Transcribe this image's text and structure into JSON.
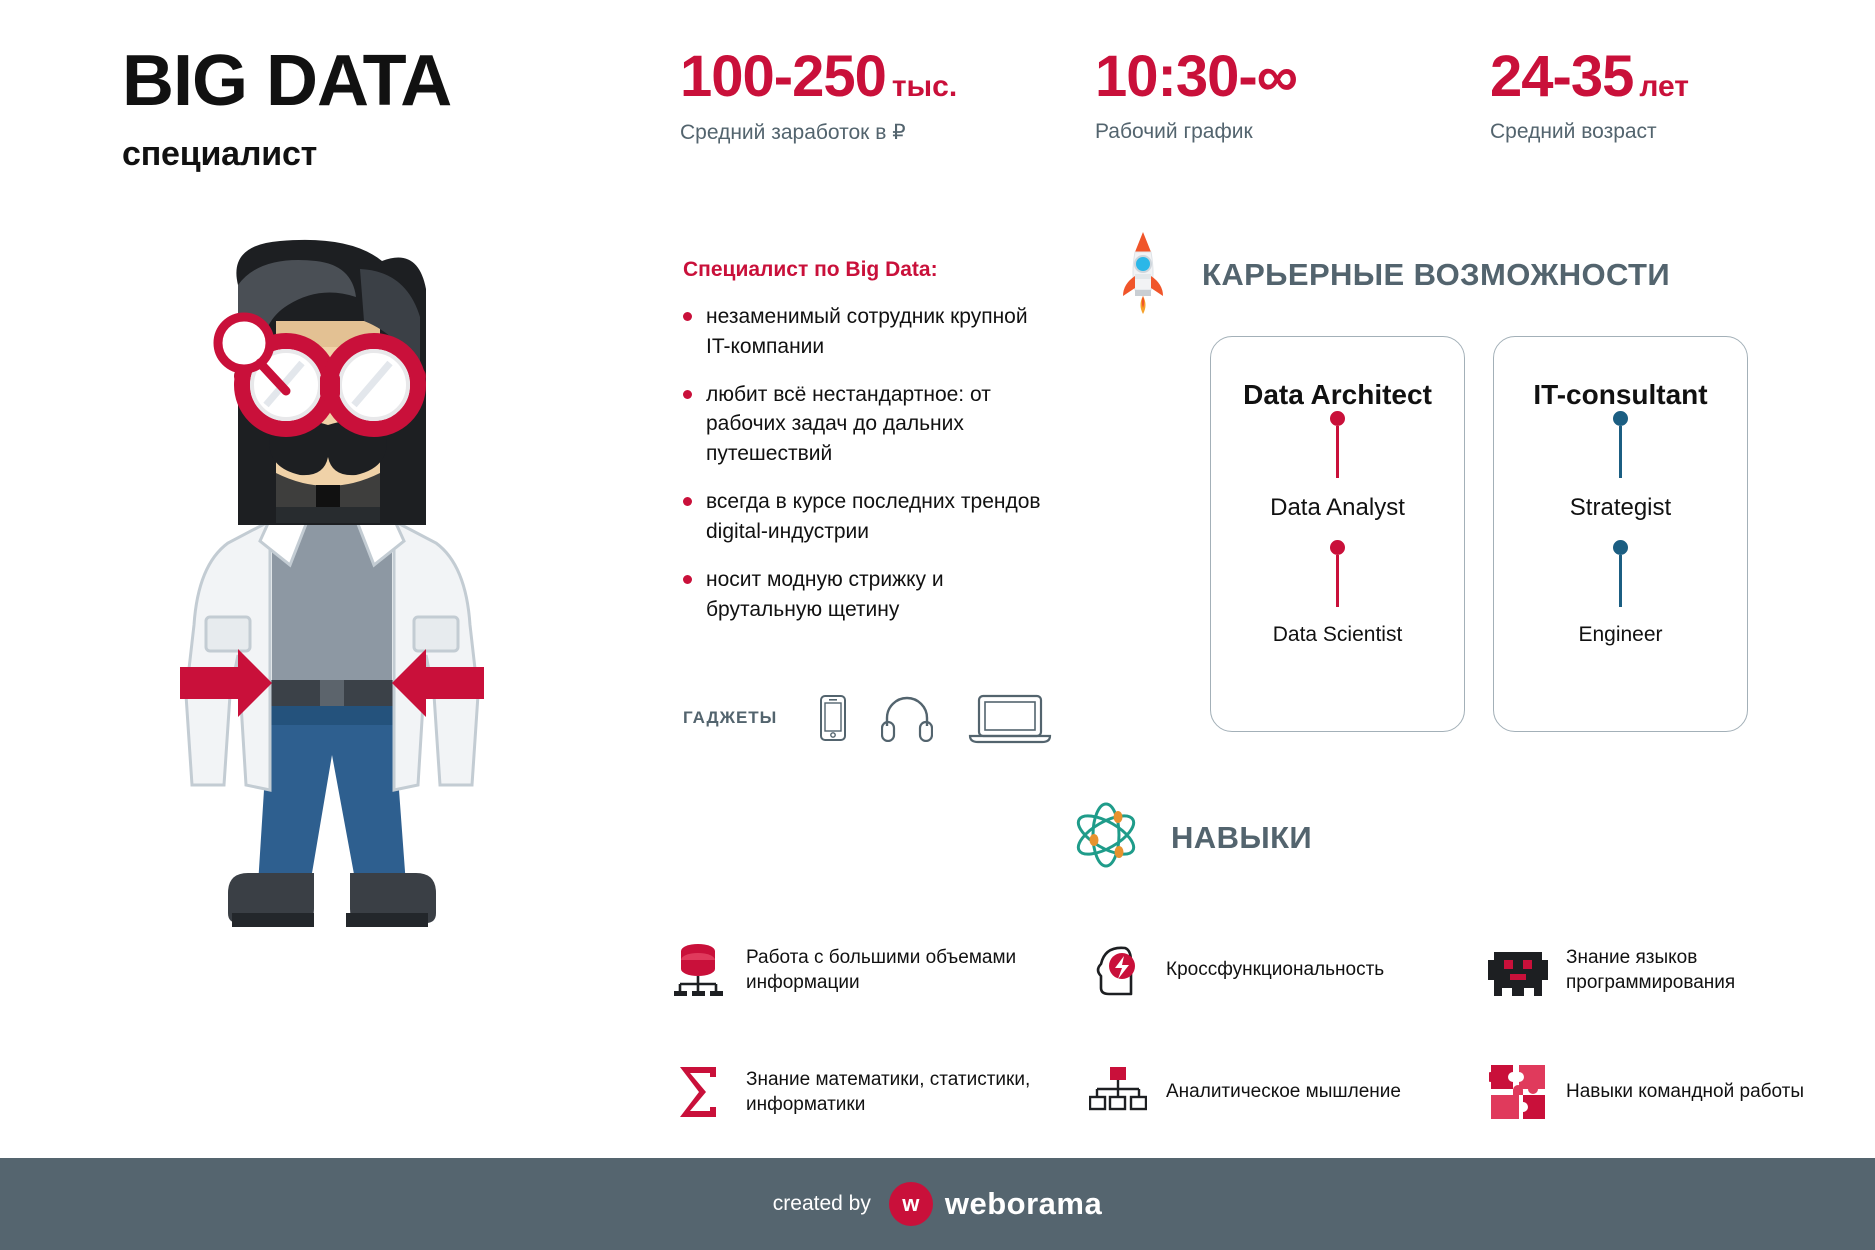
{
  "title": {
    "main": "BIG DATA",
    "sub": "специалист"
  },
  "stats": [
    {
      "value": "100-250",
      "unit": "тыс.",
      "label": "Средний заработок в ₽",
      "name": "salary"
    },
    {
      "value": "10:30-",
      "unit": "",
      "label": "Рабочий график",
      "name": "schedule",
      "infinity": "∞"
    },
    {
      "value": "24-35",
      "unit": "лет",
      "label": "Средний возраст",
      "name": "age"
    }
  ],
  "profile": {
    "heading": "Специалист по Big Data:",
    "bullets": [
      "незаменимый сотрудник крупной IT-компании",
      "любит всё нестандартное: от рабочих задач до дальних путешествий",
      "всегда в курсе последних трендов digital-индустрии",
      "носит модную стрижку и брутальную щетину"
    ]
  },
  "gadgets": {
    "label": "ГАДЖЕТЫ",
    "items": [
      "smartphone-icon",
      "headphones-icon",
      "laptop-icon"
    ]
  },
  "career": {
    "heading": "КАРЬЕРНЫЕ ВОЗМОЖНОСТИ",
    "icon": "rocket-icon",
    "cards": [
      {
        "title": "Data Architect",
        "roles": [
          "Data Analyst",
          "Data Scientist"
        ],
        "color": "#c9103a"
      },
      {
        "title": "IT-consultant",
        "roles": [
          "Strategist",
          "Engineer"
        ],
        "color": "#1b5e82"
      }
    ]
  },
  "skills": {
    "heading": "НАВЫКИ",
    "icon": "atom-icon",
    "items": [
      {
        "icon": "database-icon",
        "text": "Работа с большими объемами информации"
      },
      {
        "icon": "brain-bolt-icon",
        "text": "Кроссфункциональность"
      },
      {
        "icon": "code-invader-icon",
        "text": "Знание языков программирования"
      },
      {
        "icon": "sigma-icon",
        "text": "Знание математики, статистики, информатики"
      },
      {
        "icon": "hierarchy-icon",
        "text": "Аналитическое мышление"
      },
      {
        "icon": "puzzle-icon",
        "text": "Навыки командной работы"
      }
    ]
  },
  "footer": {
    "created_by": "created by",
    "logo_mark": "w",
    "logo_word": "weborama"
  },
  "colors": {
    "accent_red": "#c9103a",
    "slate": "#53646e",
    "card_border": "#a3b0b8",
    "blue": "#1b5e82",
    "footer_bg": "#55656f",
    "teal": "#1f9c8a",
    "orange": "#e8922e"
  }
}
